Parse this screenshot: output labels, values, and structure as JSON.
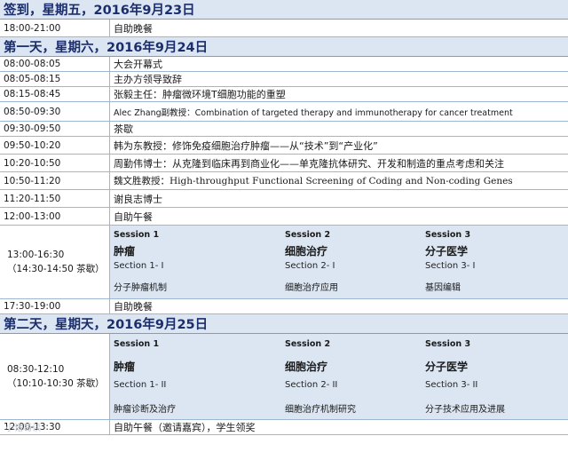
{
  "day0": {
    "header": "签到，星期五，2016年9月23日",
    "rows": [
      {
        "time": "18:00-21:00",
        "desc": "自助晚餐"
      }
    ]
  },
  "day1": {
    "header": "第一天，星期六，2016年9月24日",
    "rows": [
      {
        "time": "08:00-08:05",
        "desc": "大会开幕式"
      },
      {
        "time": "08:05-08:15",
        "desc": "主办方领导致辞"
      },
      {
        "time": "08:15-08:45",
        "desc": "张毅主任：肿瘤微环境T细胞功能的重塑"
      },
      {
        "time": "08:50-09:30",
        "desc": "Alec Zhang副教授：Combination of targeted therapy and immunotherapy for cancer treatment"
      },
      {
        "time": "09:30-09:50",
        "desc": "茶歇"
      },
      {
        "time": "09:50-10:20",
        "desc": "韩为东教授：修饰免疫细胞治疗肿瘤——从“技术”到“产业化”"
      },
      {
        "time": "10:20-10:50",
        "desc": "周勤伟博士：从克隆到临床再到商业化——单克隆抗体研究、开发和制造的重点考虑和关注"
      },
      {
        "time": "10:50-11:20",
        "desc": "魏文胜教授：High-throughput Functional Screening of Coding and Non-coding Genes"
      },
      {
        "time": "11:20-11:50",
        "desc": "谢良志博士"
      },
      {
        "time": "12:00-13:00",
        "desc": "自助午餐"
      }
    ],
    "sessions_block": {
      "time_line1": "13:00-16:30",
      "time_line2": "（14:30-14:50 茶歇）",
      "sessions": [
        {
          "name": "Session 1",
          "topic": "肿瘤",
          "section": "Section 1- I",
          "item": "分子肿瘤机制"
        },
        {
          "name": "Session 2",
          "topic": "细胞治疗",
          "section": "Section 2- I",
          "item": "细胞治疗应用"
        },
        {
          "name": "Session 3",
          "topic": "分子医学",
          "section": "Section 3- I",
          "item": "基因编辑"
        }
      ]
    },
    "after": {
      "time": "17:30-19:00",
      "desc": "自助晚餐"
    }
  },
  "day2": {
    "header": "第二天，星期天，2016年9月25日",
    "sessions_block": {
      "time_line1": "08:30-12:10",
      "time_line2": "（10:10-10:30 茶歇）",
      "sessions": [
        {
          "name": "Session 1",
          "topic": "肿瘤",
          "section": "Section 1- II",
          "item": "肿瘤诊断及治疗"
        },
        {
          "name": "Session 2",
          "topic": "细胞治疗",
          "section": "Section 2- II",
          "item": "细胞治疗机制研究"
        },
        {
          "name": "Session 3",
          "topic": "分子医学",
          "section": "Section 3- II",
          "item": "分子技术应用及进展"
        }
      ]
    },
    "last": {
      "time": "12:00-13:30",
      "desc": "自助午餐（邀请嘉宾），学生领奖"
    }
  },
  "watermark": "小诸葛读"
}
